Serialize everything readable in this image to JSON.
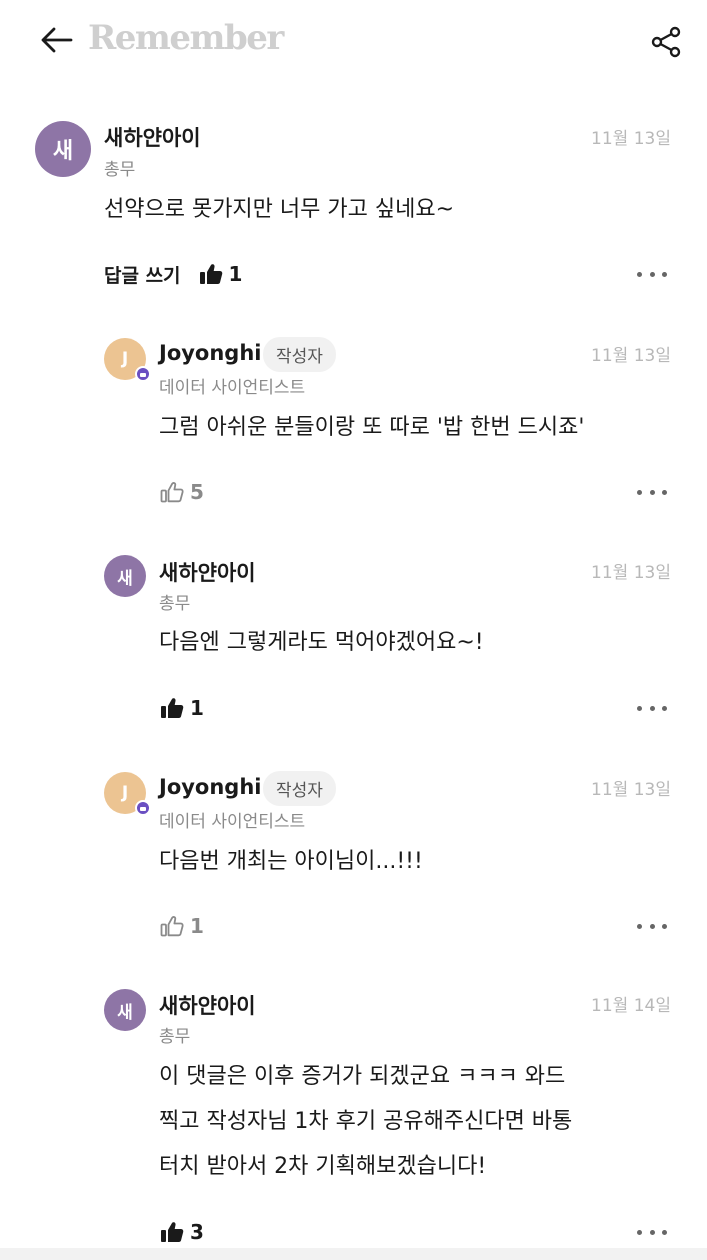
{
  "header": {
    "logo": "Remember"
  },
  "comments": [
    {
      "avatar": "새",
      "name": "새하얀아이",
      "role": "총무",
      "date": "11월 13일",
      "lines": [
        "선약으로 못가지만 너무 가고 싶네요~"
      ],
      "reply_label": "답글 쓰기",
      "likes": "1"
    },
    {
      "avatar": "J",
      "name": "Joyonghi",
      "tag": "작성자",
      "role": "데이터 사이언티스트",
      "date": "11월 13일",
      "lines": [
        "그럼 아쉬운 분들이랑 또 따로 '밥 한번 드시죠'"
      ],
      "likes": "5"
    },
    {
      "avatar": "새",
      "name": "새하얀아이",
      "role": "총무",
      "date": "11월 13일",
      "lines": [
        "다음엔 그렇게라도 먹어야겠어요~!"
      ],
      "likes": "1"
    },
    {
      "avatar": "J",
      "name": "Joyonghi",
      "tag": "작성자",
      "role": "데이터 사이언티스트",
      "date": "11월 13일",
      "lines": [
        "다음번 개최는 아이님이...!!!"
      ],
      "likes": "1"
    },
    {
      "avatar": "새",
      "name": "새하얀아이",
      "role": "총무",
      "date": "11월 14일",
      "lines": [
        "이 댓글은 이후 증거가 되겠군요 ㅋㅋㅋ 와드",
        "찍고 작성자님 1차 후기 공유해주신다면 바통",
        "터치 받아서 2차 기획해보겠습니다!"
      ],
      "likes": "3"
    }
  ],
  "colors": {
    "avatar_purple": "#8e75a6",
    "avatar_peach": "#ecc492",
    "badge": "#6a4fc2"
  },
  "icons": [
    "back-arrow-icon",
    "share-icon",
    "thumbs-up-filled-icon",
    "thumbs-up-outline-icon",
    "more-icon"
  ]
}
